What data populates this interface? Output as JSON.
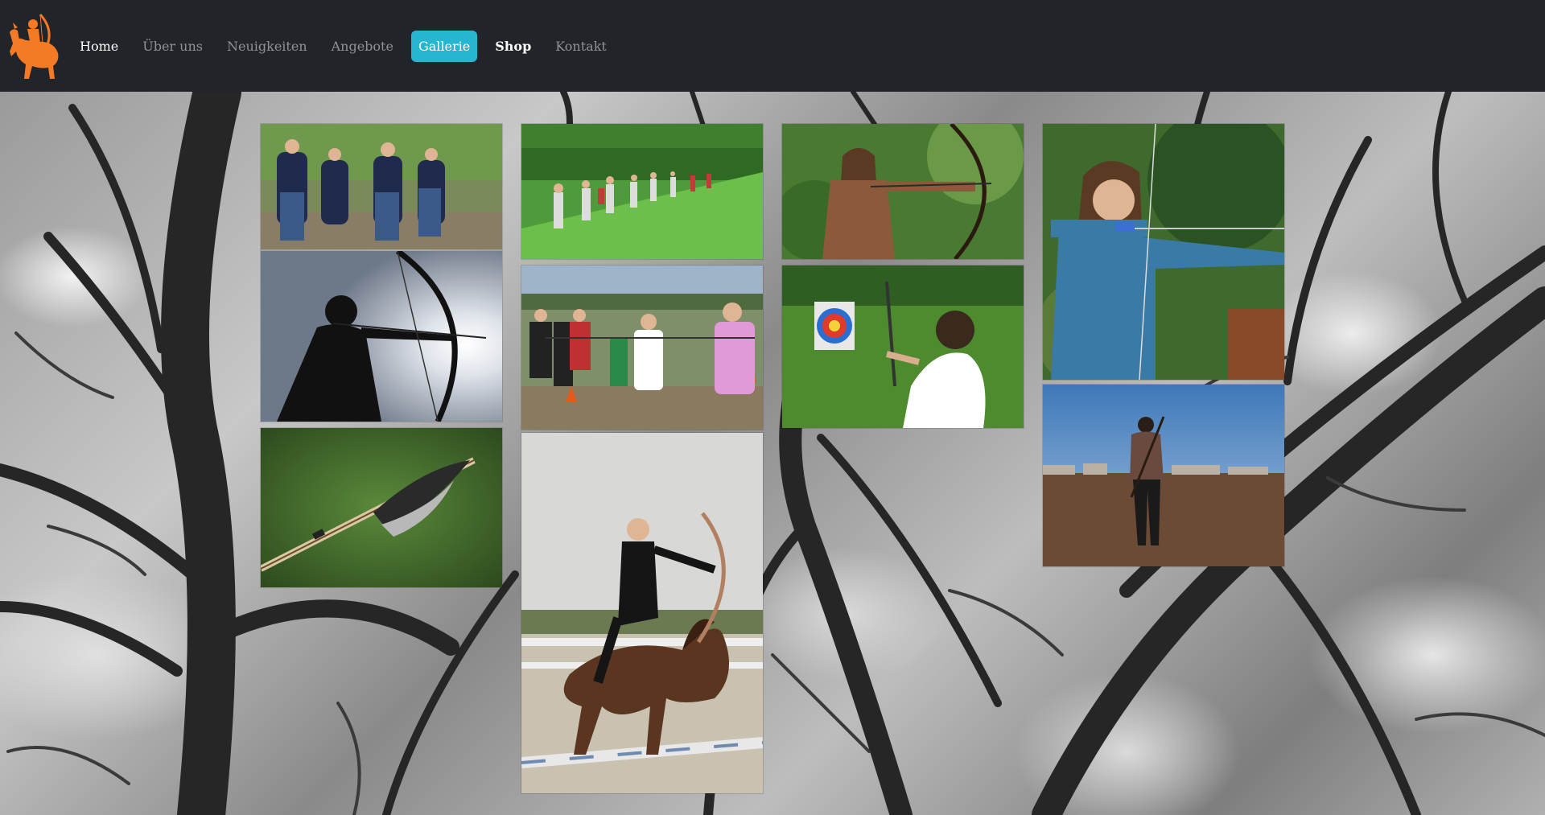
{
  "site": {
    "logo_icon": "horse-archer-logo-icon",
    "brand_color": "#f47a26",
    "accent_color": "#27b6d0"
  },
  "nav": {
    "items": [
      {
        "label": "Home",
        "state": "current"
      },
      {
        "label": "Über uns",
        "state": "normal"
      },
      {
        "label": "Neuigkeiten",
        "state": "normal"
      },
      {
        "label": "Angebote",
        "state": "normal"
      },
      {
        "label": "Gallerie",
        "state": "highlighted"
      },
      {
        "label": "Shop",
        "state": "bold"
      },
      {
        "label": "Kontakt",
        "state": "normal"
      }
    ]
  },
  "gallery": {
    "photos": [
      {
        "name": "photo-group-archers-field"
      },
      {
        "name": "photo-silhouette-archer-sun"
      },
      {
        "name": "photo-arrow-fletching"
      },
      {
        "name": "photo-archery-line-park"
      },
      {
        "name": "photo-archery-class-cones"
      },
      {
        "name": "photo-horseback-archer-jump"
      },
      {
        "name": "photo-woman-archer-forest"
      },
      {
        "name": "photo-archer-target-field"
      },
      {
        "name": "photo-girl-archer-blue-shirt"
      },
      {
        "name": "photo-archer-walking-field"
      }
    ]
  }
}
